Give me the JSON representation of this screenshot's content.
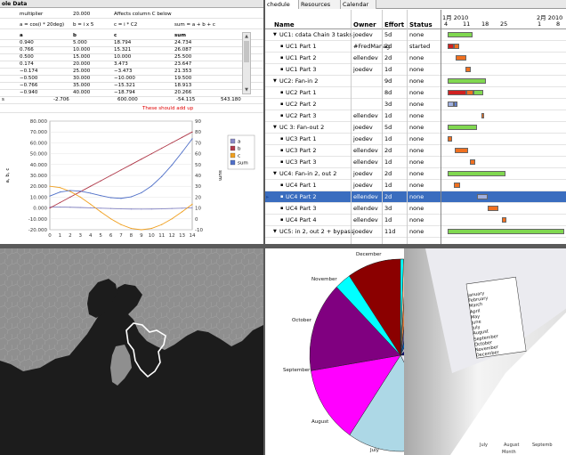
{
  "spreadsheet": {
    "title": "ole Data",
    "params": [
      {
        "a": "multiplier",
        "b": "20.000",
        "c": "Affects column C below",
        "d": ""
      },
      {
        "a": "a = cos(i * 20deg)",
        "b": "b = i x 5",
        "c": "c = i * C2",
        "d": "sum = a + b + c"
      }
    ],
    "headers": [
      "a",
      "b",
      "c",
      "sum"
    ],
    "rows": [
      [
        "0.940",
        "5.000",
        "18.794",
        "24.734"
      ],
      [
        "0.766",
        "10.000",
        "15.321",
        "26.087"
      ],
      [
        "0.500",
        "15.000",
        "10.000",
        "25.500"
      ],
      [
        "0.174",
        "20.000",
        "3.473",
        "23.647"
      ],
      [
        "−0.174",
        "25.000",
        "−3.473",
        "21.353"
      ],
      [
        "−0.500",
        "30.000",
        "−10.000",
        "19.500"
      ],
      [
        "−0.766",
        "35.000",
        "−15.321",
        "18.913"
      ],
      [
        "−0.940",
        "40.000",
        "−18.794",
        "20.266"
      ]
    ],
    "totals_label": "s",
    "totals": [
      "-2.706",
      "600.000",
      "-54.115",
      "543.180"
    ],
    "note": "These should add up"
  },
  "chart_data": {
    "type": "line",
    "x": [
      0,
      1,
      2,
      3,
      4,
      5,
      6,
      7,
      8,
      9,
      10,
      11,
      12,
      13,
      14
    ],
    "ylabel": "a, b, c",
    "y2label": "sum",
    "ylim": [
      -20,
      80
    ],
    "y2lim": [
      -10,
      90
    ],
    "yticks": [
      "-20.000",
      "-10.000",
      "0.000",
      "10.000",
      "20.000",
      "30.000",
      "40.000",
      "50.000",
      "60.000",
      "70.000",
      "80.000"
    ],
    "y2ticks": [
      "-10",
      "0",
      "10",
      "20",
      "30",
      "40",
      "50",
      "60",
      "70",
      "80",
      "90"
    ],
    "legend_position": "right",
    "series": [
      {
        "name": "a",
        "axis": "left",
        "values": [
          1,
          0.94,
          0.77,
          0.5,
          0.17,
          -0.17,
          -0.5,
          -0.77,
          -0.94,
          -1,
          -0.94,
          -0.77,
          -0.5,
          -0.17,
          0.17
        ]
      },
      {
        "name": "b",
        "axis": "left",
        "values": [
          0,
          5,
          10,
          15,
          20,
          25,
          30,
          35,
          40,
          45,
          50,
          55,
          60,
          65,
          70
        ]
      },
      {
        "name": "c",
        "axis": "left",
        "values": [
          20,
          18.8,
          15.3,
          10,
          3.5,
          -3.5,
          -10,
          -15.3,
          -18.8,
          -20,
          -18.8,
          -15.3,
          -10,
          -3.5,
          3.5
        ]
      },
      {
        "name": "sum",
        "axis": "right",
        "values": [
          21,
          24.7,
          26.1,
          25.5,
          23.7,
          21.4,
          19.5,
          18.9,
          20.3,
          24,
          30.3,
          39,
          49.5,
          61.3,
          73.7
        ]
      }
    ],
    "colors": {
      "a": "#8a8ac8",
      "b": "#b03a4a",
      "c": "#f0a020",
      "sum": "#5070c8"
    }
  },
  "gantt": {
    "tabs": [
      "chedule",
      "Resources",
      "Calendar"
    ],
    "columns": {
      "name": "Name",
      "owner": "Owner",
      "effort": "Effort",
      "status": "Status"
    },
    "timeline": {
      "month1": "1月 2010",
      "month2": "2月 2010",
      "days": [
        "4",
        "11",
        "18",
        "25",
        "1",
        "8"
      ]
    },
    "rows": [
      {
        "name": "UC1: cdata Chain 3 tasks",
        "owner": "joedev",
        "effort": "5d",
        "status": "none",
        "group": true
      },
      {
        "name": "UC1 Part 1",
        "owner": "#FredManag",
        "effort": "2d",
        "status": "started"
      },
      {
        "name": "UC1 Part 2",
        "owner": "ellendev",
        "effort": "2d",
        "status": "none"
      },
      {
        "name": "UC1 Part 3",
        "owner": "joedev",
        "effort": "1d",
        "status": "none"
      },
      {
        "name": "UC2: Fan-in 2",
        "owner": "",
        "effort": "9d",
        "status": "none",
        "group": true
      },
      {
        "name": "UC2 Part 1",
        "owner": "",
        "effort": "8d",
        "status": "none"
      },
      {
        "name": "UC2 Part 2",
        "owner": "",
        "effort": "3d",
        "status": "none"
      },
      {
        "name": "UC2 Part 3",
        "owner": "ellendev",
        "effort": "1d",
        "status": "none"
      },
      {
        "name": "UC 3: Fan-out 2",
        "owner": "joedev",
        "effort": "5d",
        "status": "none",
        "group": true
      },
      {
        "name": "UC3 Part 1",
        "owner": "joedev",
        "effort": "1d",
        "status": "none"
      },
      {
        "name": "UC3 Part 2",
        "owner": "ellendev",
        "effort": "2d",
        "status": "none"
      },
      {
        "name": "UC3 Part 3",
        "owner": "ellendev",
        "effort": "1d",
        "status": "none"
      },
      {
        "name": "UC4: Fan-in 2, out 2",
        "owner": "joedev",
        "effort": "2d",
        "status": "none",
        "group": true
      },
      {
        "name": "UC4 Part 1",
        "owner": "joedev",
        "effort": "1d",
        "status": "none"
      },
      {
        "name": "UC4 Part 2",
        "owner": "ellendev",
        "effort": "2d",
        "status": "none",
        "selected": true
      },
      {
        "name": "UC4 Part 3",
        "owner": "ellendev",
        "effort": "3d",
        "status": "none"
      },
      {
        "name": "UC4 Part 4",
        "owner": "ellendev",
        "effort": "1d",
        "status": "none"
      },
      {
        "name": "UC5: in 2, out 2 + bypass",
        "owner": "joedev",
        "effort": "11d",
        "status": "none",
        "group": true
      }
    ]
  },
  "pie": {
    "months": [
      "January",
      "February",
      "March",
      "April",
      "May",
      "June",
      "July",
      "August",
      "September",
      "October",
      "November",
      "December"
    ],
    "axis_labels": [
      "July",
      "August",
      "Septemb",
      "Month"
    ],
    "colors": [
      "#0a0a60",
      "#f5c0a0",
      "#e08040",
      "#2a2a7a",
      "#0060c0",
      "#b0b0d0",
      "#000080",
      "#e8e8f8",
      "#add8e6",
      "#ff00ff",
      "#800080",
      "#00ffff",
      "#8b0000"
    ]
  }
}
